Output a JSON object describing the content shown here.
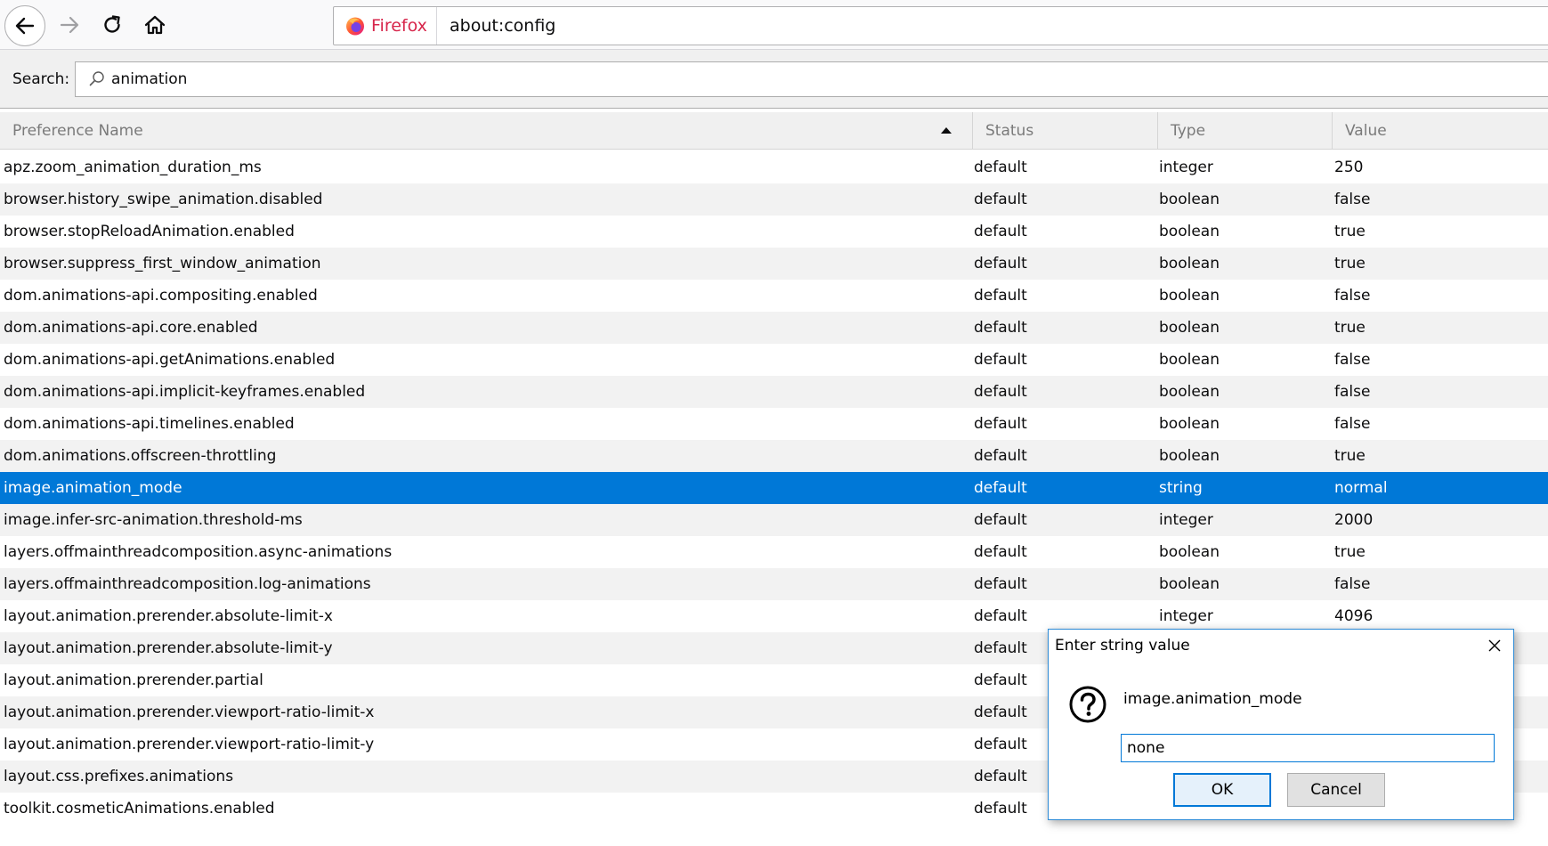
{
  "colors": {
    "accent": "#0078d7",
    "firefox_brand": "#d7264b",
    "row_alt": "#f2f2f2"
  },
  "toolbar": {
    "back_icon": "arrow-left-icon",
    "forward_icon": "arrow-right-icon",
    "reload_icon": "reload-icon",
    "home_icon": "home-icon"
  },
  "urlbar": {
    "identity_label": "Firefox",
    "url": "about:config"
  },
  "search": {
    "label": "Search:",
    "value": "animation"
  },
  "table": {
    "columns": {
      "name": "Preference Name",
      "status": "Status",
      "type": "Type",
      "value": "Value"
    },
    "rows": [
      {
        "name": "apz.zoom_animation_duration_ms",
        "status": "default",
        "type": "integer",
        "value": "250"
      },
      {
        "name": "browser.history_swipe_animation.disabled",
        "status": "default",
        "type": "boolean",
        "value": "false"
      },
      {
        "name": "browser.stopReloadAnimation.enabled",
        "status": "default",
        "type": "boolean",
        "value": "true"
      },
      {
        "name": "browser.suppress_first_window_animation",
        "status": "default",
        "type": "boolean",
        "value": "true"
      },
      {
        "name": "dom.animations-api.compositing.enabled",
        "status": "default",
        "type": "boolean",
        "value": "false"
      },
      {
        "name": "dom.animations-api.core.enabled",
        "status": "default",
        "type": "boolean",
        "value": "true"
      },
      {
        "name": "dom.animations-api.getAnimations.enabled",
        "status": "default",
        "type": "boolean",
        "value": "false"
      },
      {
        "name": "dom.animations-api.implicit-keyframes.enabled",
        "status": "default",
        "type": "boolean",
        "value": "false"
      },
      {
        "name": "dom.animations-api.timelines.enabled",
        "status": "default",
        "type": "boolean",
        "value": "false"
      },
      {
        "name": "dom.animations.offscreen-throttling",
        "status": "default",
        "type": "boolean",
        "value": "true"
      },
      {
        "name": "image.animation_mode",
        "status": "default",
        "type": "string",
        "value": "normal",
        "selected": true
      },
      {
        "name": "image.infer-src-animation.threshold-ms",
        "status": "default",
        "type": "integer",
        "value": "2000"
      },
      {
        "name": "layers.offmainthreadcomposition.async-animations",
        "status": "default",
        "type": "boolean",
        "value": "true"
      },
      {
        "name": "layers.offmainthreadcomposition.log-animations",
        "status": "default",
        "type": "boolean",
        "value": "false"
      },
      {
        "name": "layout.animation.prerender.absolute-limit-x",
        "status": "default",
        "type": "integer",
        "value": "4096"
      },
      {
        "name": "layout.animation.prerender.absolute-limit-y",
        "status": "default",
        "type": "",
        "value": ""
      },
      {
        "name": "layout.animation.prerender.partial",
        "status": "default",
        "type": "",
        "value": ""
      },
      {
        "name": "layout.animation.prerender.viewport-ratio-limit-x",
        "status": "default",
        "type": "",
        "value": ""
      },
      {
        "name": "layout.animation.prerender.viewport-ratio-limit-y",
        "status": "default",
        "type": "",
        "value": ""
      },
      {
        "name": "layout.css.prefixes.animations",
        "status": "default",
        "type": "",
        "value": ""
      },
      {
        "name": "toolkit.cosmeticAnimations.enabled",
        "status": "default",
        "type": "",
        "value": ""
      }
    ]
  },
  "dialog": {
    "title": "Enter string value",
    "message": "image.animation_mode",
    "input_value": "none",
    "ok_label": "OK",
    "cancel_label": "Cancel"
  }
}
